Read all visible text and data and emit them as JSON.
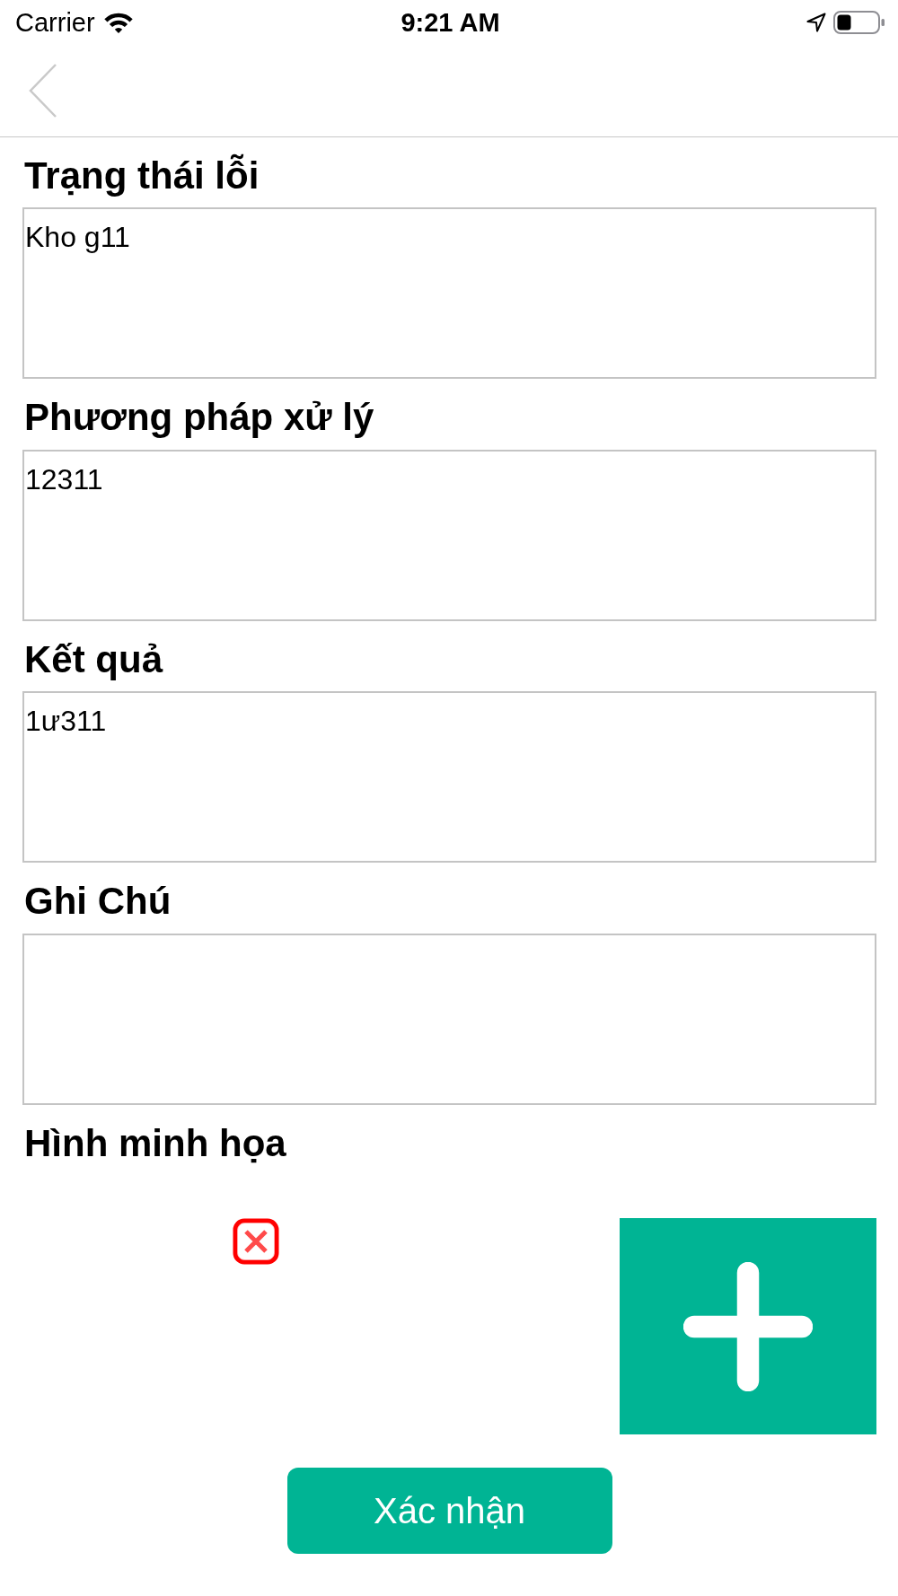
{
  "status_bar": {
    "carrier": "Carrier",
    "time": "9:21 AM"
  },
  "fields": [
    {
      "label": "Trạng thái lỗi",
      "value": "Kho g11"
    },
    {
      "label": "Phương pháp xử lý",
      "value": "12311"
    },
    {
      "label": "Kết quả",
      "value": "1ư311"
    },
    {
      "label": "Ghi Chú"
    }
  ],
  "images": {
    "label": "Hình minh họa"
  },
  "confirm_button": {
    "label": "Xác nhận"
  }
}
